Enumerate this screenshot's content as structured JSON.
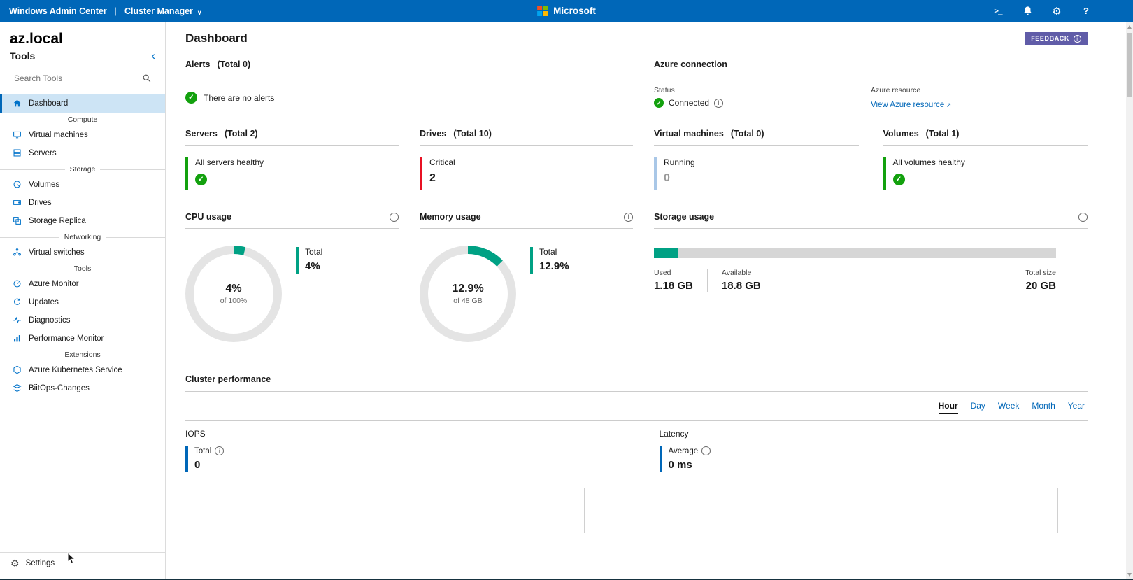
{
  "topbar": {
    "app_title": "Windows Admin Center",
    "solution_label": "Cluster Manager",
    "brand": "Microsoft"
  },
  "sidebar": {
    "cluster_name": "az.local",
    "tools_label": "Tools",
    "search_placeholder": "Search Tools",
    "sections": {
      "compute": "Compute",
      "storage": "Storage",
      "networking": "Networking",
      "tools": "Tools",
      "extensions": "Extensions"
    },
    "items": [
      {
        "label": "Dashboard"
      },
      {
        "label": "Virtual machines"
      },
      {
        "label": "Servers"
      },
      {
        "label": "Volumes"
      },
      {
        "label": "Drives"
      },
      {
        "label": "Storage Replica"
      },
      {
        "label": "Virtual switches"
      },
      {
        "label": "Azure Monitor"
      },
      {
        "label": "Updates"
      },
      {
        "label": "Diagnostics"
      },
      {
        "label": "Performance Monitor"
      },
      {
        "label": "Azure Kubernetes Service"
      },
      {
        "label": "BiitOps-Changes"
      }
    ],
    "settings_label": "Settings"
  },
  "main": {
    "page_title": "Dashboard",
    "feedback_label": "FEEDBACK",
    "alerts": {
      "title": "Alerts",
      "total": "(Total 0)",
      "message": "There are no alerts"
    },
    "azure": {
      "title": "Azure connection",
      "status_label": "Status",
      "status_value": "Connected",
      "resource_label": "Azure resource",
      "resource_link": "View Azure resource"
    },
    "servers": {
      "title": "Servers",
      "total": "(Total 2)",
      "status": "All servers healthy"
    },
    "drives": {
      "title": "Drives",
      "total": "(Total 10)",
      "status": "Critical",
      "value": "2"
    },
    "vms": {
      "title": "Virtual machines",
      "total": "(Total 0)",
      "status": "Running",
      "value": "0"
    },
    "volumes": {
      "title": "Volumes",
      "total": "(Total 1)",
      "status": "All volumes healthy"
    },
    "cpu": {
      "title": "CPU usage",
      "center_value": "4%",
      "center_sub": "of 100%",
      "legend_label": "Total",
      "legend_value": "4%",
      "percent": 4
    },
    "memory": {
      "title": "Memory usage",
      "center_value": "12.9%",
      "center_sub": "of 48 GB",
      "legend_label": "Total",
      "legend_value": "12.9%",
      "percent": 12.9
    },
    "storage": {
      "title": "Storage usage",
      "used_label": "Used",
      "used_value": "1.18 GB",
      "available_label": "Available",
      "available_value": "18.8 GB",
      "total_label": "Total size",
      "total_value": "20 GB",
      "used_percent": 5.9
    },
    "performance": {
      "title": "Cluster performance",
      "tabs": [
        "Hour",
        "Day",
        "Week",
        "Month",
        "Year"
      ],
      "active_tab": "Hour",
      "iops": {
        "label": "IOPS",
        "legend_label": "Total",
        "value": "0"
      },
      "latency": {
        "label": "Latency",
        "legend_label": "Average",
        "value": "0 ms"
      }
    }
  },
  "colors": {
    "topbar_blue": "#0067b8",
    "accent_blue": "#0072c9",
    "teal": "#00a184",
    "green": "#13a10e",
    "red": "#e81123",
    "light_blue": "#a9c7e7",
    "feedback_purple": "#605ca8"
  }
}
